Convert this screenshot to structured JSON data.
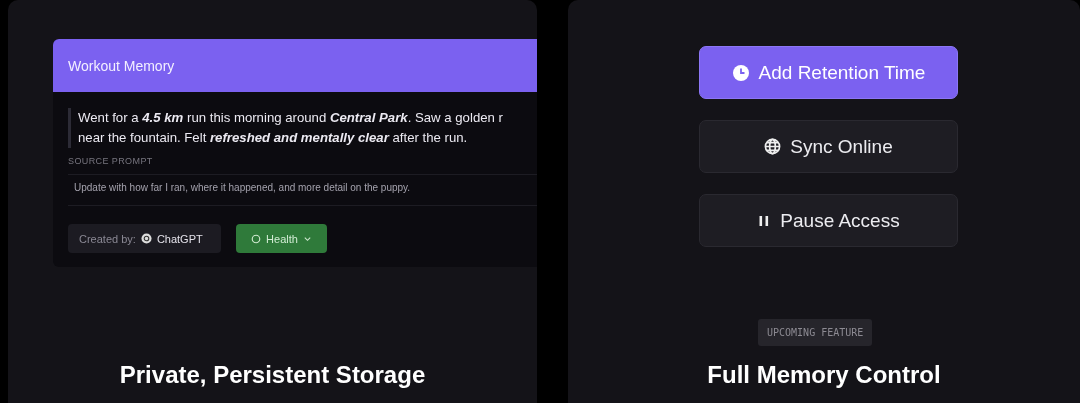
{
  "left_panel": {
    "card": {
      "title": "Workout Memory",
      "memory_lines": [
        "Went for a **4.5 km** run this morning around **Central Park**. Saw a golden r",
        "near the fountain. Felt **refreshed and mentally clear** after the run."
      ],
      "source_label": "SOURCE PROMPT",
      "source_prompt": "Update with how far I ran, where it happened, and more detail on the puppy.",
      "created_by_label": "Created by:",
      "creator": "ChatGPT",
      "category": "Health"
    },
    "caption": "Private, Persistent Storage"
  },
  "right_panel": {
    "buttons": [
      {
        "label": "Add Retention Time",
        "kind": "clock",
        "primary": true
      },
      {
        "label": "Sync Online",
        "kind": "globe",
        "primary": false
      },
      {
        "label": "Pause Access",
        "kind": "pause",
        "primary": false
      }
    ],
    "badge": "UPCOMING FEATURE",
    "caption": "Full Memory Control"
  }
}
